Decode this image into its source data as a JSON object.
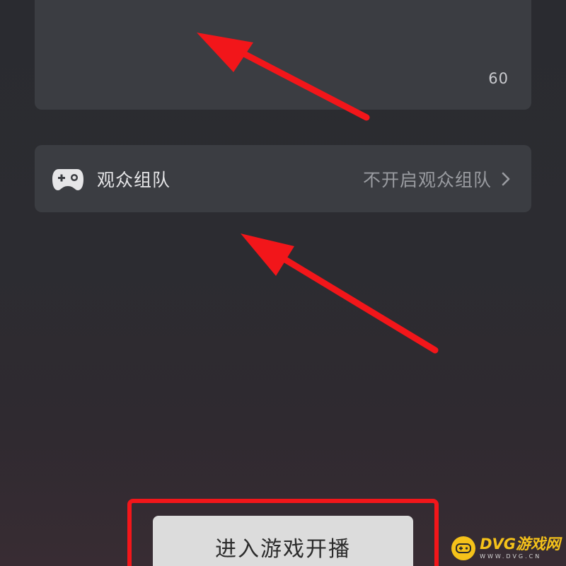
{
  "description_card": {
    "char_count": "60"
  },
  "audience_team": {
    "icon": "gamepad-icon",
    "label": "观众组队",
    "value": "不开启观众组队",
    "chevron": "chevron-right-icon"
  },
  "start_button": {
    "label": "进入游戏开播"
  },
  "annotations": {
    "color": "#f2161a"
  },
  "watermark": {
    "title": "DVG游戏网",
    "subtitle": "WWW.DVG.CN"
  }
}
